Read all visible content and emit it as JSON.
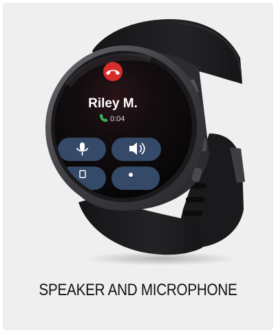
{
  "caption": "SPEAKER AND MICROPHONE",
  "watch_screen": {
    "caller_name": "Riley M.",
    "call_timer": "0:04",
    "icons": {
      "end_call": "phone-hangup-icon",
      "active_call": "phone-icon",
      "microphone": "microphone-icon",
      "speaker": "speaker-icon"
    }
  },
  "colors": {
    "background": "#efefef",
    "strap": "#1c1c1e",
    "bezel": "#4a4a4e",
    "screen": "#0d0d0f",
    "end_call_red": "#d82c2c",
    "call_green": "#3bb45a",
    "button_blue": "#344a68"
  }
}
